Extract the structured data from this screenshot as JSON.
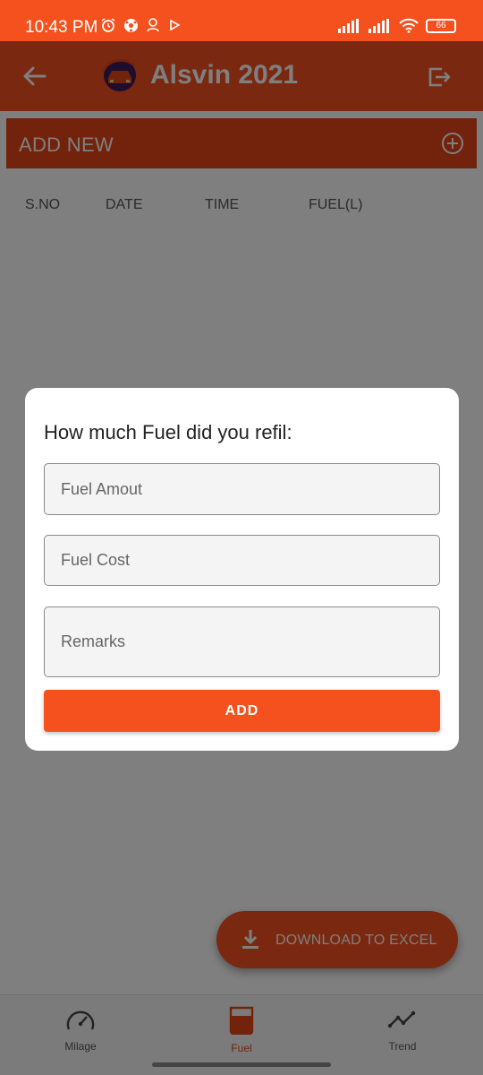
{
  "status_bar": {
    "time": "10:43 PM",
    "battery": "66"
  },
  "app_bar": {
    "title": "Alsvin 2021"
  },
  "add_new": {
    "label": "ADD NEW"
  },
  "table": {
    "headers": [
      "S.NO",
      "DATE",
      "TIME",
      "FUEL(L)"
    ]
  },
  "dialog": {
    "title": "How much Fuel did you refil:",
    "fuel_amount_placeholder": "Fuel Amout",
    "fuel_cost_placeholder": "Fuel Cost",
    "remarks_placeholder": "Remarks",
    "add_label": "ADD"
  },
  "fab": {
    "label": "DOWNLOAD TO EXCEL",
    "icon": "download-icon"
  },
  "bottom_nav": {
    "items": [
      {
        "label": "Milage",
        "icon": "speedometer-icon",
        "active": false
      },
      {
        "label": "Fuel",
        "icon": "fuel-can-icon",
        "active": true
      },
      {
        "label": "Trend",
        "icon": "trend-line-icon",
        "active": false
      }
    ]
  },
  "colors": {
    "primary": "#f4511e",
    "primary_dark": "#e64419",
    "scrim": "rgba(0,0,0,0.5)"
  }
}
